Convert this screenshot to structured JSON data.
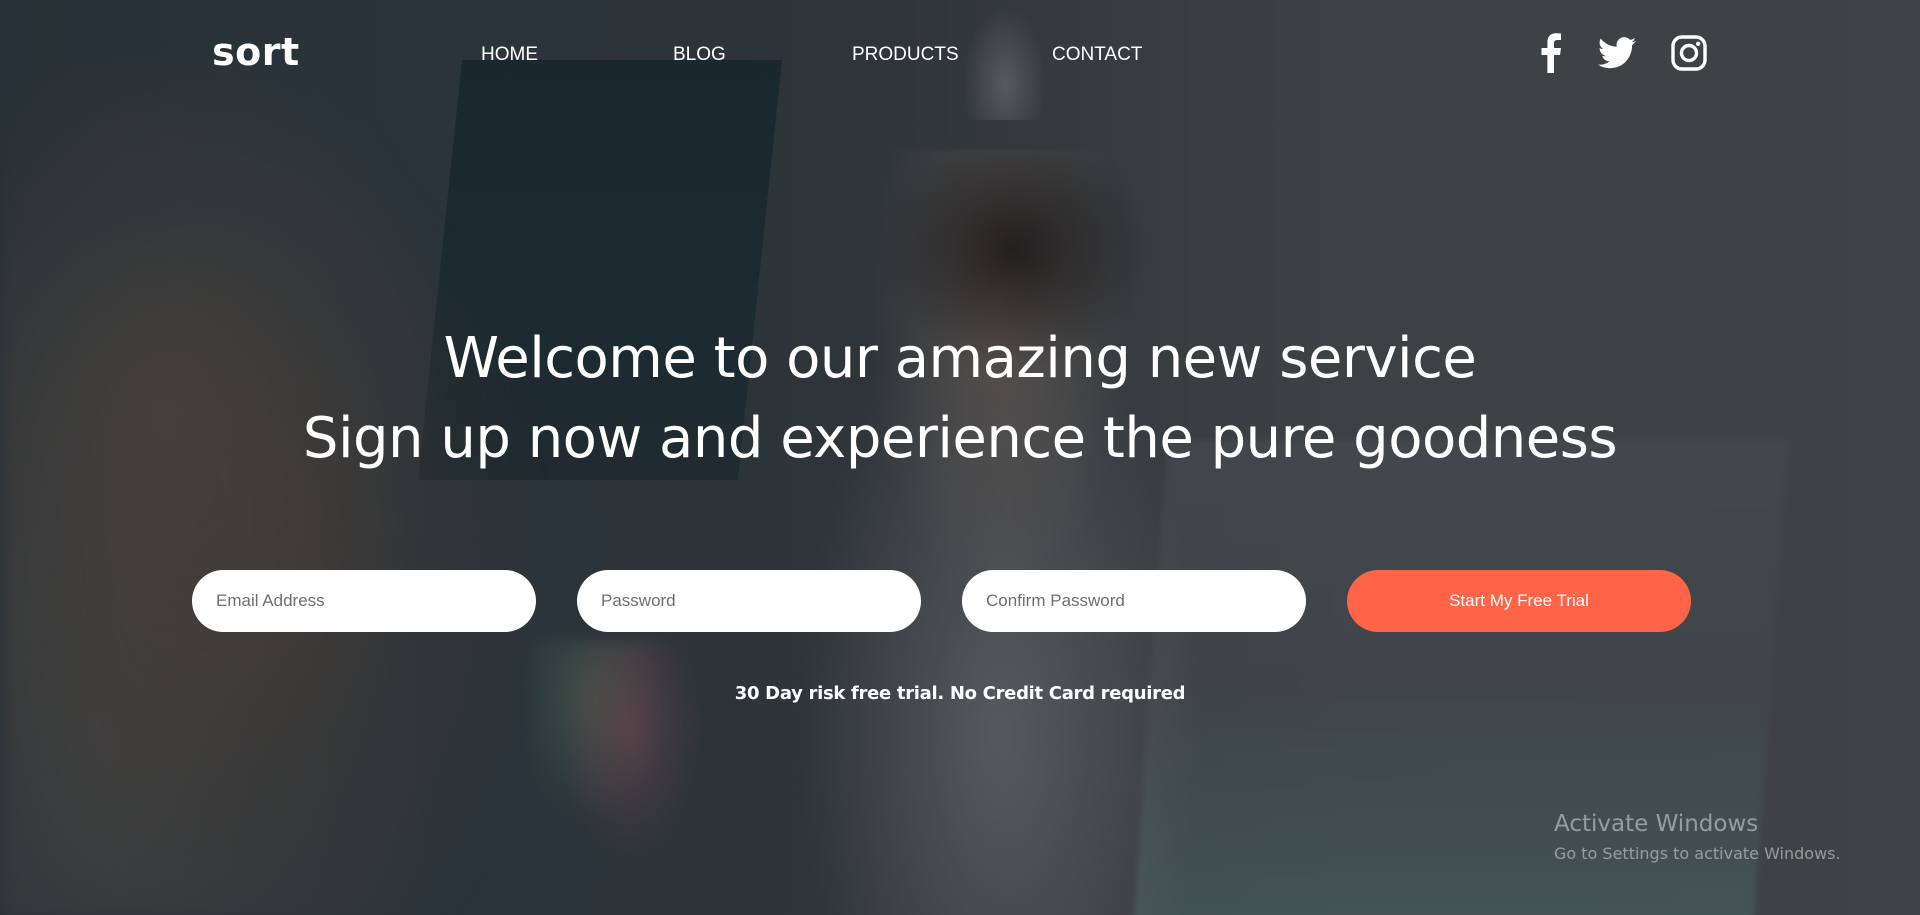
{
  "header": {
    "logo": "sort",
    "nav": [
      {
        "label": "HOME"
      },
      {
        "label": "BLOG"
      },
      {
        "label": "PRODUCTS"
      },
      {
        "label": "CONTACT"
      }
    ],
    "social": [
      {
        "icon": "facebook-icon"
      },
      {
        "icon": "twitter-icon"
      },
      {
        "icon": "instagram-icon"
      }
    ]
  },
  "hero": {
    "line1": "Welcome to our amazing new service",
    "line2": "Sign up now and experience the pure goodness"
  },
  "form": {
    "email_placeholder": "Email Address",
    "password_placeholder": "Password",
    "confirm_placeholder": "Confirm Password",
    "cta_label": "Start My Free Trial",
    "note": "30 Day risk free trial. No Credit Card required"
  },
  "watermark": {
    "title": "Activate Windows",
    "subtitle": "Go to Settings to activate Windows."
  },
  "colors": {
    "accent": "#ff6348",
    "overlay": "#16181c"
  }
}
